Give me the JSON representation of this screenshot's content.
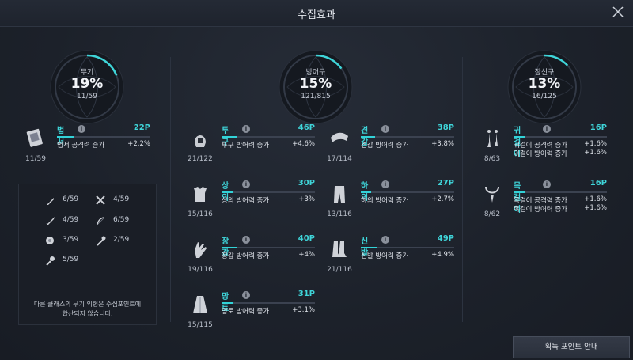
{
  "window": {
    "title": "수집효과"
  },
  "categories": [
    {
      "name": "무기",
      "percent": "19%",
      "count": "11/59",
      "progress": 0.19
    },
    {
      "name": "방어구",
      "percent": "15%",
      "count": "121/815",
      "progress": 0.15
    },
    {
      "name": "장신구",
      "percent": "13%",
      "count": "16/125",
      "progress": 0.13
    }
  ],
  "weapon_items": [
    {
      "name": "법서",
      "points": "22P",
      "count": "11/59",
      "stats": [
        {
          "label": "법서 공격력 증가",
          "value": "+2.2%"
        }
      ],
      "progress": 0.19
    }
  ],
  "armor_items": [
    {
      "name": "투구",
      "points": "46P",
      "count": "21/122",
      "stats": [
        {
          "label": "투구 방어력 증가",
          "value": "+4.6%"
        }
      ],
      "progress": 0.17
    },
    {
      "name": "견갑",
      "points": "38P",
      "count": "17/114",
      "stats": [
        {
          "label": "견갑 방어력 증가",
          "value": "+3.8%"
        }
      ],
      "progress": 0.15
    },
    {
      "name": "상의",
      "points": "30P",
      "count": "15/116",
      "stats": [
        {
          "label": "상의 방어력 증가",
          "value": "+3%"
        }
      ],
      "progress": 0.13
    },
    {
      "name": "하의",
      "points": "27P",
      "count": "13/116",
      "stats": [
        {
          "label": "하의 방어력 증가",
          "value": "+2.7%"
        }
      ],
      "progress": 0.11
    },
    {
      "name": "장갑",
      "points": "40P",
      "count": "19/116",
      "stats": [
        {
          "label": "장갑 방어력 증가",
          "value": "+4%"
        }
      ],
      "progress": 0.16
    },
    {
      "name": "신발",
      "points": "49P",
      "count": "21/116",
      "stats": [
        {
          "label": "신발 방어력 증가",
          "value": "+4.9%"
        }
      ],
      "progress": 0.18
    },
    {
      "name": "망토",
      "points": "31P",
      "count": "15/115",
      "stats": [
        {
          "label": "망토 방어력 증가",
          "value": "+3.1%"
        }
      ],
      "progress": 0.13
    }
  ],
  "accessory_items": [
    {
      "name": "귀걸이",
      "points": "16P",
      "count": "8/63",
      "stats": [
        {
          "label": "귀걸이 공격력 증가",
          "value": "+1.6%"
        },
        {
          "label": "귀걸이 방어력 증가",
          "value": "+1.6%"
        }
      ],
      "progress": 0.13
    },
    {
      "name": "목걸이",
      "points": "16P",
      "count": "8/62",
      "stats": [
        {
          "label": "목걸이 공격력 증가",
          "value": "+1.6%"
        },
        {
          "label": "목걸이 방어력 증가",
          "value": "+1.6%"
        }
      ],
      "progress": 0.13
    }
  ],
  "other_weapons": {
    "items": [
      {
        "icon": "dagger-icon",
        "count": "6/59"
      },
      {
        "icon": "crossed-swords-icon",
        "count": "4/59"
      },
      {
        "icon": "sword-icon",
        "count": "4/59"
      },
      {
        "icon": "bow-icon",
        "count": "6/59"
      },
      {
        "icon": "orb-icon",
        "count": "3/59"
      },
      {
        "icon": "staff-icon",
        "count": "2/59"
      },
      {
        "icon": "mace-icon",
        "count": "5/59"
      }
    ],
    "note_line1": "다른 클래스의  무기 외형은 수집포인트에",
    "note_line2": "합산되지 않습니다."
  },
  "footer": {
    "guide_button": "획득 포인트 안내"
  },
  "colors": {
    "accent": "#3fd5d9",
    "background": "#1c212b"
  }
}
